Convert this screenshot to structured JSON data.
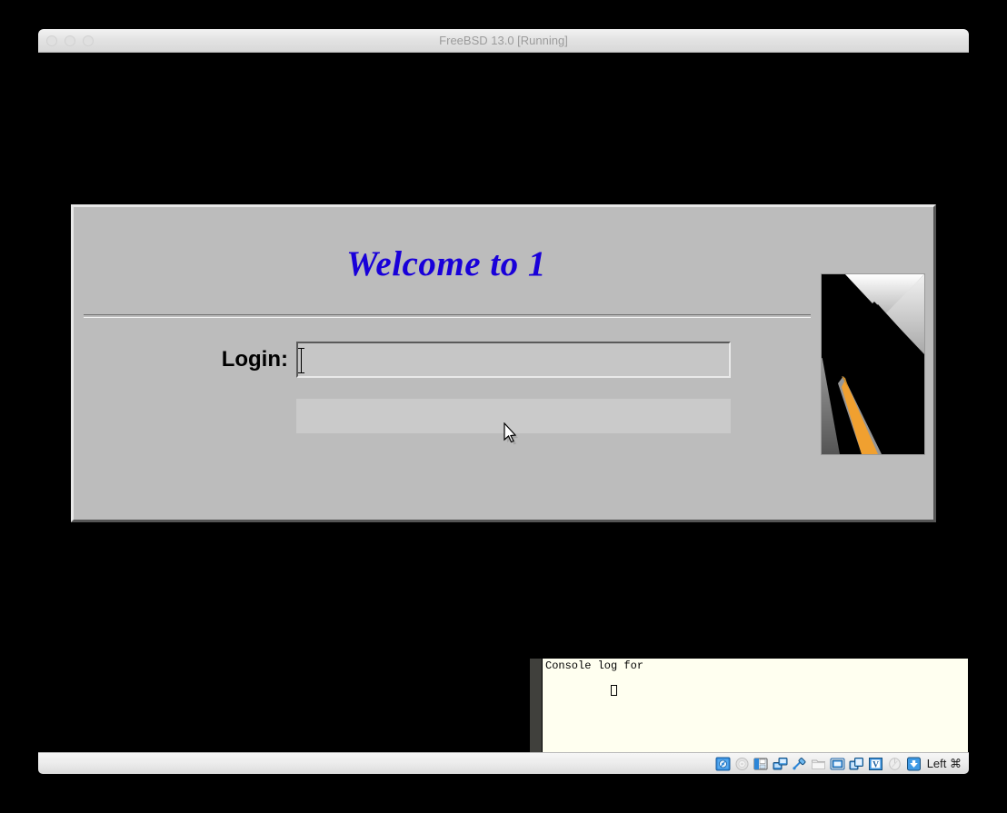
{
  "window": {
    "title": "FreeBSD 13.0 [Running]",
    "traffic_lights": [
      "close-button",
      "minimize-button",
      "zoom-button"
    ]
  },
  "login_dialog": {
    "welcome_text": "Welcome to 1",
    "login_label": "Login:",
    "login_value": "",
    "login_placeholder": "",
    "message_text": "",
    "logo_name": "kde-logo-graphic",
    "colors": {
      "face": "#bcbcbc",
      "title_blue": "#1900d9",
      "field": "#c6c6c6",
      "panel": "#cacaca"
    }
  },
  "xconsole": {
    "line1": "Console log for",
    "caret": "",
    "bg_color": "#fffff0"
  },
  "statusbar": {
    "host_key_label": "Left ⌘",
    "icons": [
      {
        "name": "hard-disk-icon",
        "state": "active"
      },
      {
        "name": "optical-disk-icon",
        "state": "inactive"
      },
      {
        "name": "floppy-disk-icon",
        "state": "active"
      },
      {
        "name": "network-icon",
        "state": "active"
      },
      {
        "name": "usb-icon",
        "state": "active"
      },
      {
        "name": "shared-folders-icon",
        "state": "inactive"
      },
      {
        "name": "display-icon",
        "state": "active"
      },
      {
        "name": "video-capture-icon",
        "state": "active"
      },
      {
        "name": "virtualbox-chip-icon",
        "state": "active"
      },
      {
        "name": "mouse-icon",
        "state": "inactive"
      },
      {
        "name": "host-key-arrow-icon",
        "state": "active"
      }
    ]
  }
}
